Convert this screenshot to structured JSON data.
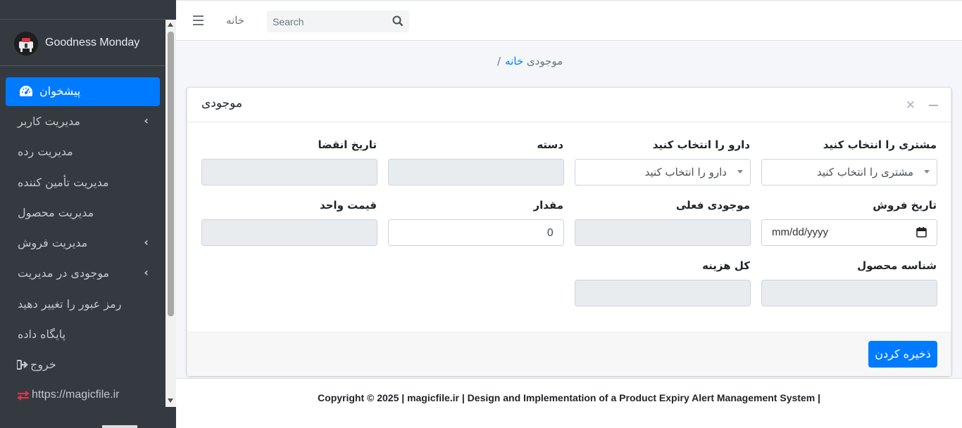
{
  "brand": {
    "name": "Goodness Monday"
  },
  "sidebar": {
    "items": [
      {
        "label": "پیشخوان",
        "icon": "dashboard-icon",
        "active": true
      },
      {
        "label": "مدیریت کاربر",
        "has_children": true
      },
      {
        "label": "مدیریت رده"
      },
      {
        "label": "مدیریت تأمین کننده"
      },
      {
        "label": "مدیریت محصول"
      },
      {
        "label": "مدیریت فروش",
        "has_children": true
      },
      {
        "label": "موجودی در مدیریت",
        "has_children": true
      },
      {
        "label": "رمز عبور را تغییر دهید"
      },
      {
        "label": "پایگاه داده"
      },
      {
        "label": "خروج",
        "icon": "logout-icon"
      },
      {
        "label": "https://magicfile.ir",
        "icon": "exchange-icon"
      }
    ]
  },
  "navbar": {
    "home_link": "خانه",
    "search_placeholder": "Search"
  },
  "breadcrumb": {
    "home": "خانه",
    "current": "/موجودی"
  },
  "card": {
    "title": "موجودی",
    "fields": {
      "customer": {
        "label": "مشتری را انتخاب کنید",
        "value": "مشتری را انتخاب کنید"
      },
      "drug": {
        "label": "دارو را انتخاب کنید",
        "value": "دارو را انتخاب کنید"
      },
      "batch": {
        "label": "دسته",
        "value": ""
      },
      "expiry_date": {
        "label": "تاریخ انقضا",
        "value": ""
      },
      "sale_date": {
        "label": "تاریخ فروش",
        "value": "mm/dd/yyyy"
      },
      "current_stock": {
        "label": "موجودی فعلی",
        "value": ""
      },
      "quantity": {
        "label": "مقدار",
        "value": "0"
      },
      "unit_price": {
        "label": "قیمت واحد",
        "value": ""
      },
      "product_id": {
        "label": "شناسه محصول",
        "value": ""
      },
      "total_cost": {
        "label": "کل هزینه",
        "value": ""
      }
    },
    "save_label": "ذخیره کردن"
  },
  "footer": {
    "text": "Copyright © 2025 | magicfile.ir | Design and Implementation of a Product Expiry Alert Management System |"
  },
  "colors": {
    "primary": "#007bff",
    "sidebar_bg": "#343a40",
    "accent_red": "#dc3545"
  }
}
